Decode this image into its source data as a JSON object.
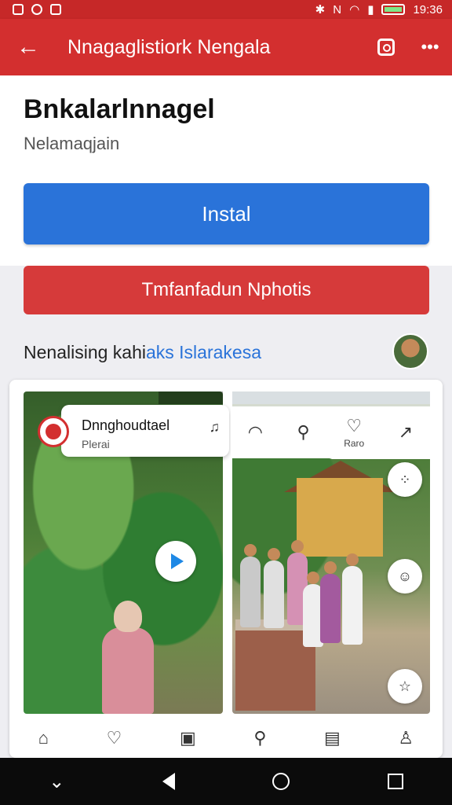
{
  "status_bar": {
    "time": "19:36"
  },
  "app_bar": {
    "back_icon": "arrow-left-icon",
    "title": "Nnagaglistiork Nengala",
    "actions": [
      "search-icon",
      "more-vert-icon"
    ]
  },
  "header": {
    "app_name": "Bnkalarlnnagel",
    "developer": "Nelamaqjain",
    "install_label": "Instal"
  },
  "secondary_button": {
    "label": "Tmfanfadun Nphotis"
  },
  "section": {
    "label_prefix": "Nenalising kahi",
    "label_link": "aks Islarakesa"
  },
  "card": {
    "toast": {
      "title": "Dnnghoudtael",
      "subtitle": "Plerai"
    },
    "mini_toolbar": {
      "icons": [
        "wifi-icon",
        "search-user-icon",
        "heart-pin-icon",
        "share-icon"
      ],
      "caption": "Raro"
    },
    "bottom_nav": [
      "home-icon",
      "heart-icon",
      "bookmark-icon",
      "search-icon",
      "image-icon",
      "profile-icon"
    ]
  },
  "colors": {
    "app_bar": "#d32f2f",
    "install_button": "#2a73d9",
    "secondary_button": "#d63a3a",
    "link": "#2a73d9"
  }
}
